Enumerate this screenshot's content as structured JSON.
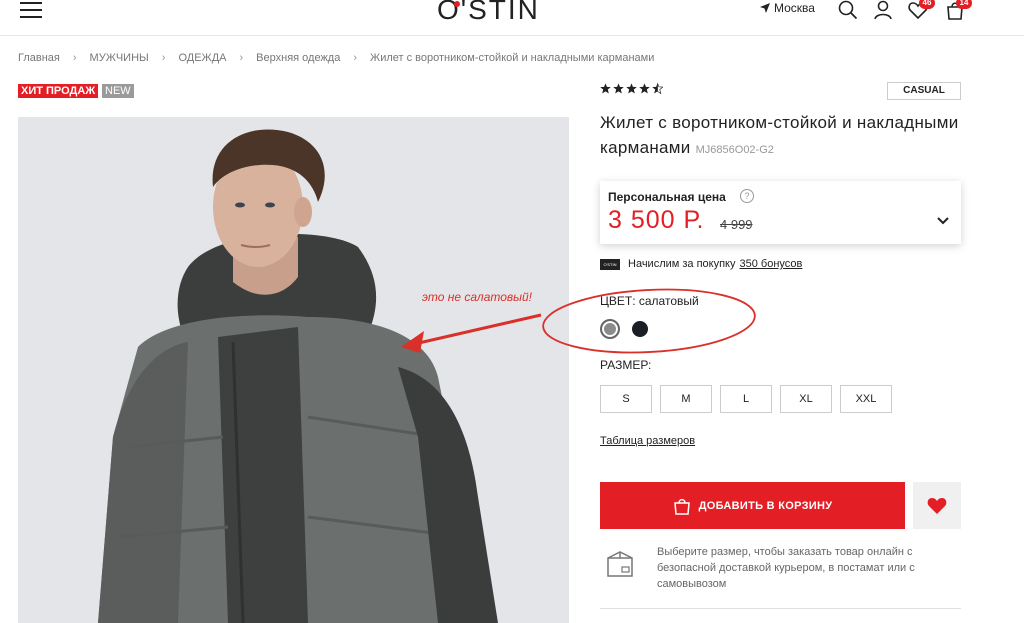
{
  "header": {
    "logo": "O'STIN",
    "city": "Москва",
    "favorites_count": "46",
    "cart_count": "14"
  },
  "breadcrumb": [
    "Главная",
    "МУЖЧИНЫ",
    "ОДЕЖДА",
    "Верхняя одежда",
    "Жилет с воротником-стойкой и накладными карманами"
  ],
  "badges": {
    "hit": "ХИТ ПРОДАЖ",
    "new": "NEW"
  },
  "annotation": {
    "text": "это не салатовый!",
    "color": "#d9302a"
  },
  "product": {
    "rating_stars": 4.5,
    "style_tag": "CASUAL",
    "title": "Жилет с воротником-стойкой и накладными карманами",
    "sku": "MJ6856O02-G2",
    "price_label": "Персональная цена",
    "price_current": "3 500 Р.",
    "price_old": "4 999",
    "bonus_text": "Начислим за покупку",
    "bonus_link": "350 бонусов",
    "color_label": "ЦВЕТ: салатовый",
    "colors": [
      "#8a8b8d",
      "#1b1e26"
    ],
    "size_label": "РАЗМЕР:",
    "sizes": [
      "S",
      "M",
      "L",
      "XL",
      "XXL"
    ],
    "size_table": "Таблица размеров",
    "add_to_cart": "ДОБАВИТЬ В КОРЗИНУ",
    "delivery_text": "Выберите размер, чтобы заказать товар онлайн с безопасной доставкой курьером, в постамат или с самовывозом"
  },
  "colors": {
    "accent": "#e31e24"
  }
}
